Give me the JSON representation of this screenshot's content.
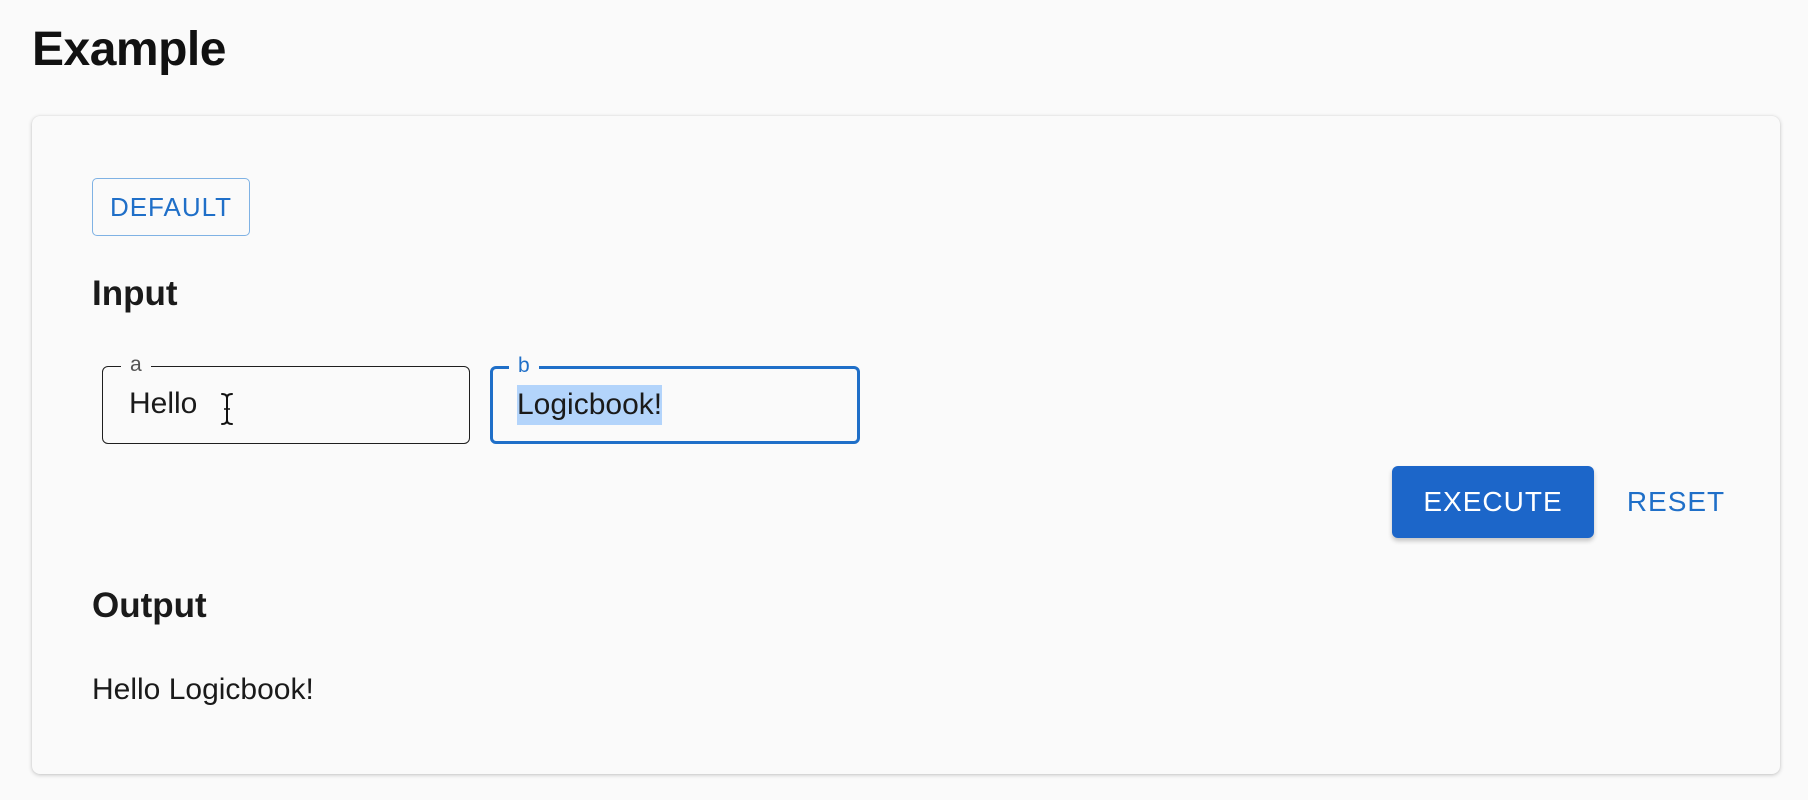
{
  "page": {
    "title": "Example"
  },
  "card": {
    "default_button_label": "DEFAULT",
    "input_heading": "Input",
    "fields": [
      {
        "label": "a",
        "value": "Hello"
      },
      {
        "label": "b",
        "value": "Logicbook!"
      }
    ],
    "execute_label": "EXECUTE",
    "reset_label": "RESET",
    "output_heading": "Output",
    "output_text": "Hello Logicbook!"
  },
  "colors": {
    "accent": "#1c66c9",
    "selection": "#b3d4fb",
    "background": "#fafafa"
  },
  "icons": {
    "cursor": "text-cursor-icon"
  }
}
